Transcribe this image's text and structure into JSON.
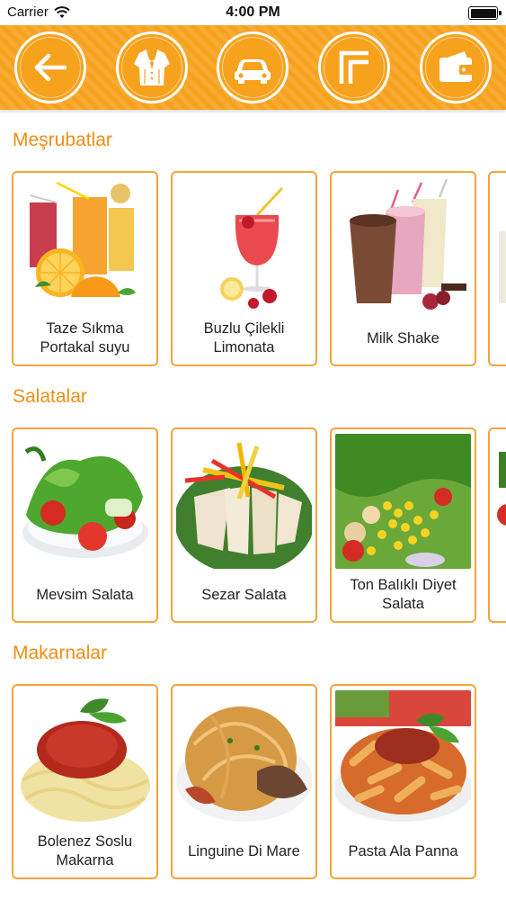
{
  "status_bar": {
    "carrier": "Carrier",
    "time": "4:00 PM"
  },
  "toolbar": {
    "buttons": [
      {
        "icon": "back-arrow-icon"
      },
      {
        "icon": "tuxedo-icon"
      },
      {
        "icon": "car-icon"
      },
      {
        "icon": "corner-icon"
      },
      {
        "icon": "wallet-icon"
      }
    ]
  },
  "sections": [
    {
      "title": "Meşrubatlar",
      "items": [
        {
          "name": "Taze Sıkma Portakal suyu"
        },
        {
          "name": "Buzlu Çilekli Limonata"
        },
        {
          "name": "Milk Shake"
        }
      ]
    },
    {
      "title": "Salatalar",
      "items": [
        {
          "name": "Mevsim Salata"
        },
        {
          "name": "Sezar Salata"
        },
        {
          "name": "Ton Balıklı Diyet Salata"
        }
      ]
    },
    {
      "title": "Makarnalar",
      "items": [
        {
          "name": "Bolenez Soslu Makarna"
        },
        {
          "name": "Linguine Di Mare"
        },
        {
          "name": "Pasta Ala Panna"
        }
      ]
    }
  ],
  "colors": {
    "accent": "#f7a21d",
    "section_title": "#ef8d12",
    "card_border": "#f3a438"
  }
}
